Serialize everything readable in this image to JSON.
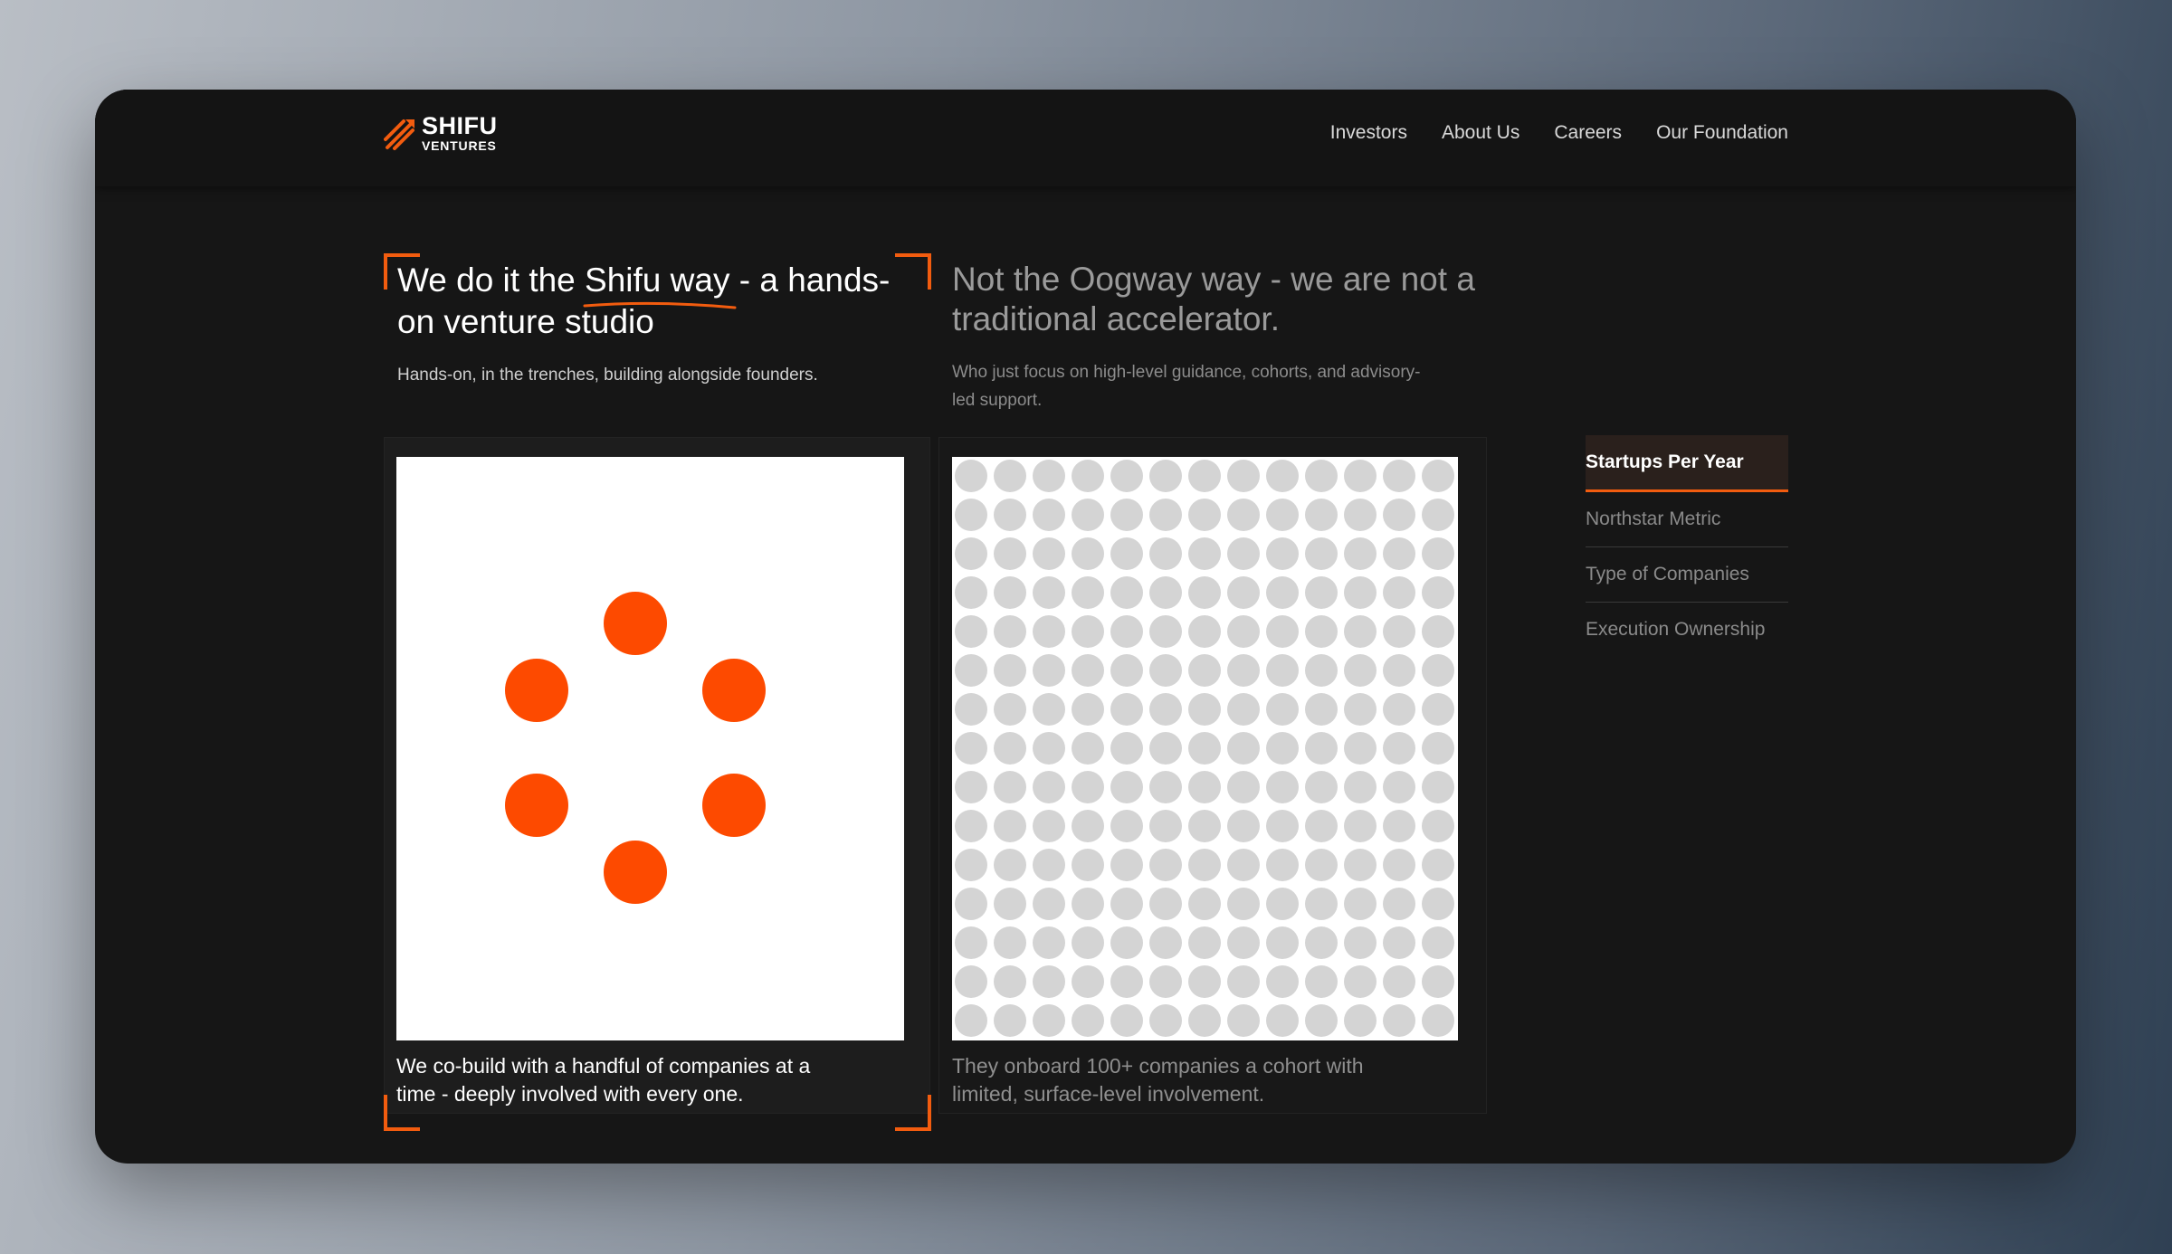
{
  "brand": {
    "name_line1": "SHIFU",
    "name_line2": "VENTURES",
    "accent_color": "#f25c0f",
    "logo_icon": "rocket-stripes-icon"
  },
  "nav": {
    "items": [
      "Investors",
      "About Us",
      "Careers",
      "Our Foundation"
    ]
  },
  "shifu": {
    "heading_pre": "We do it the ",
    "heading_highlight": "Shifu way",
    "heading_post": " - a hands-on venture studio",
    "subtext": "Hands-on, in the trenches, building alongside founders.",
    "caption": "We co-build with a handful of companies at a time - deeply involved with every one.",
    "companies_shown": 6,
    "dot_color": "#fd4a00"
  },
  "oogway": {
    "heading": "Not the Oogway way - we are not a traditional accelerator.",
    "subtext": "Who just focus on high-level guidance, cohorts, and advisory-led support.",
    "caption": "They onboard 100+ companies a cohort with limited, surface-level involvement.",
    "grid_columns": 13,
    "grid_rows": 15,
    "dot_color": "#d4d4d4"
  },
  "tabs": {
    "items": [
      "Startups Per Year",
      "Northstar Metric",
      "Type of Companies",
      "Execution Ownership"
    ],
    "active_index": 0
  }
}
